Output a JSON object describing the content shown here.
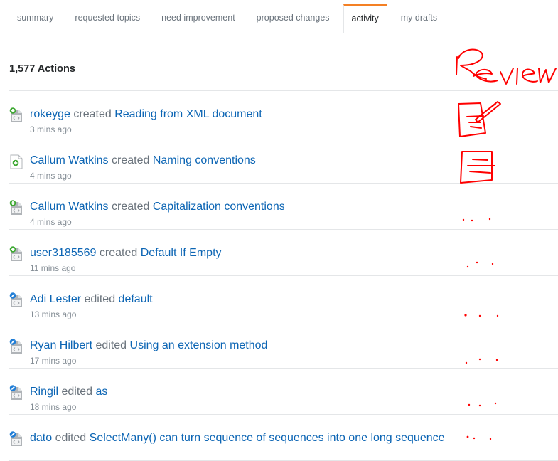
{
  "tabs": [
    {
      "label": "summary",
      "active": false
    },
    {
      "label": "requested topics",
      "active": false
    },
    {
      "label": "need improvement",
      "active": false
    },
    {
      "label": "proposed changes",
      "active": false
    },
    {
      "label": "activity",
      "active": true
    },
    {
      "label": "my drafts",
      "active": false
    }
  ],
  "header": {
    "title": "1,577 Actions"
  },
  "annotation": {
    "handwritten_text": "Review",
    "color": "#ff0000"
  },
  "colors": {
    "accent": "#f48024",
    "link": "#0c65b4",
    "created_badge": "#3da832",
    "edited_badge": "#1f7dd6"
  },
  "activity": [
    {
      "icon": "code-page-created-icon",
      "user": "rokeyge",
      "verb": "created",
      "target": "Reading from XML document",
      "time": "3 mins ago"
    },
    {
      "icon": "page-created-icon",
      "user": "Callum Watkins",
      "verb": "created",
      "target": "Naming conventions",
      "time": "4 mins ago"
    },
    {
      "icon": "code-page-created-icon",
      "user": "Callum Watkins",
      "verb": "created",
      "target": "Capitalization conventions",
      "time": "4 mins ago"
    },
    {
      "icon": "code-page-created-icon",
      "user": "user3185569",
      "verb": "created",
      "target": "Default If Empty",
      "time": "11 mins ago"
    },
    {
      "icon": "code-page-edited-icon",
      "user": "Adi Lester",
      "verb": "edited",
      "target": "default",
      "time": "13 mins ago"
    },
    {
      "icon": "code-page-edited-icon",
      "user": "Ryan Hilbert",
      "verb": "edited",
      "target": "Using an extension method",
      "time": "17 mins ago"
    },
    {
      "icon": "code-page-edited-icon",
      "user": "Ringil",
      "verb": "edited",
      "target": "as",
      "time": "18 mins ago"
    },
    {
      "icon": "code-page-edited-icon",
      "user": "dato",
      "verb": "edited",
      "target": "SelectMany() can turn sequence of sequences into one long sequence",
      "time": ""
    }
  ]
}
